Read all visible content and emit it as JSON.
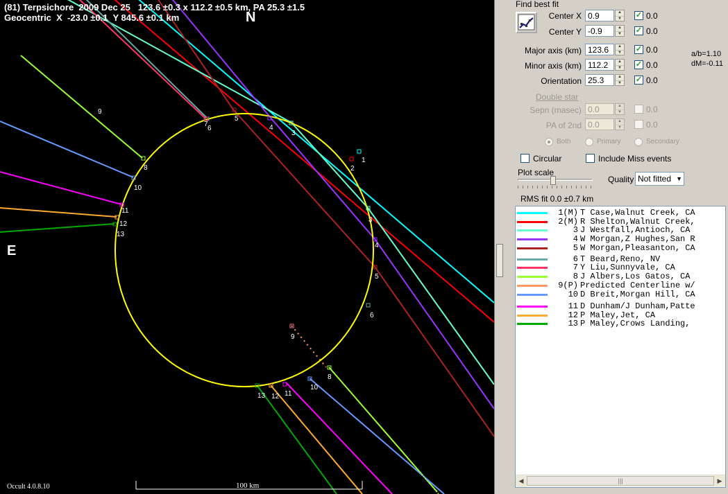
{
  "plot": {
    "title_line1": "(81) Terpsichore  2009 Dec 25   123.6 ±0.3 x 112.2 ±0.5 km, PA 25.3 ±1.5",
    "title_line2": "Geocentric  X  -23.0 ±0.1  Y 845.6 ±0.1 km",
    "north_label": "N",
    "east_label": "E",
    "version": "Occult 4.0.8.10",
    "scale_label": "100 km",
    "background_color": "#000000",
    "ellipse_color": "#ffff00",
    "chord_markers": [
      {
        "label": "1",
        "color": "#00ffff"
      },
      {
        "label": "2",
        "color": "#ff0000"
      },
      {
        "label": "3",
        "color": "#66ffcc"
      },
      {
        "label": "4",
        "color": "#9933ff"
      },
      {
        "label": "5",
        "color": "#aa2222"
      },
      {
        "label": "6",
        "color": "#66aaaa"
      },
      {
        "label": "7",
        "color": "#ff3366"
      },
      {
        "label": "8",
        "color": "#99ff33"
      },
      {
        "label": "9",
        "color": "#ff6699"
      },
      {
        "label": "10",
        "color": "#6699ff"
      },
      {
        "label": "11",
        "color": "#ff00ff"
      },
      {
        "label": "12",
        "color": "#ffaa33"
      },
      {
        "label": "13",
        "color": "#00aa00"
      }
    ]
  },
  "panel": {
    "find_best_fit": "Find best fit",
    "center_x_label": "Center X",
    "center_x_value": "0.9",
    "center_x_unc": "0.0",
    "center_y_label": "Center Y",
    "center_y_value": "-0.9",
    "center_y_unc": "0.0",
    "major_label": "Major axis (km)",
    "major_value": "123.6",
    "major_unc": "0.0",
    "minor_label": "Minor axis (km)",
    "minor_value": "112.2",
    "minor_unc": "0.0",
    "orient_label": "Orientation",
    "orient_value": "25.3",
    "orient_unc": "0.0",
    "ab_ratio": "a/b=1.10",
    "dm": "dM=-0.11",
    "double_star": "Double star",
    "sepn_label": "Sepn (masec)",
    "sepn_value": "0.0",
    "sepn_unc": "0.0",
    "pa2_label": "PA of 2nd",
    "pa2_value": "0.0",
    "pa2_unc": "0.0",
    "radio_both": "Both",
    "radio_primary": "Primary",
    "radio_secondary": "Secondary",
    "circular_label": "Circular",
    "include_miss_label": "Include Miss events",
    "plot_scale_label": "Plot scale",
    "plot_scale_level": 0.46,
    "quality_label": "Quality",
    "quality_value": "Not fitted",
    "rms_fit": "RMS fit 0.0 ±0.7 km"
  },
  "observers": [
    {
      "num": "1(M)",
      "name": "T Case,Walnut Creek, CA",
      "color": "#00ffff"
    },
    {
      "num": "2(M)",
      "name": "R Shelton,Walnut Creek,",
      "color": "#ff0000"
    },
    {
      "num": "3",
      "name": "J Westfall,Antioch, CA",
      "color": "#66ffcc"
    },
    {
      "num": "4",
      "name": "W Morgan,Z Hughes,San R",
      "color": "#9933ff"
    },
    {
      "num": "5",
      "name": "W Morgan,Pleasanton, CA",
      "color": "#aa2222"
    },
    {
      "num": "6",
      "name": "T Beard,Reno, NV",
      "color": "#66aaaa"
    },
    {
      "num": "7",
      "name": "Y Liu,Sunnyvale, CA",
      "color": "#ff3366"
    },
    {
      "num": "8",
      "name": "J Albers,Los Gatos, CA",
      "color": "#99ff33"
    },
    {
      "num": "9(P)",
      "name": "Predicted Centerline w/",
      "color": "#ff9966"
    },
    {
      "num": "10",
      "name": "D Breit,Morgan Hill, CA",
      "color": "#6699ff"
    },
    {
      "num": "11",
      "name": "D Dunham/J Dunham,Patte",
      "color": "#ff00ff"
    },
    {
      "num": "12",
      "name": "P Maley,Jet, CA",
      "color": "#ffaa33"
    },
    {
      "num": "13",
      "name": "P Maley,Crows Landing,",
      "color": "#00aa00"
    }
  ]
}
